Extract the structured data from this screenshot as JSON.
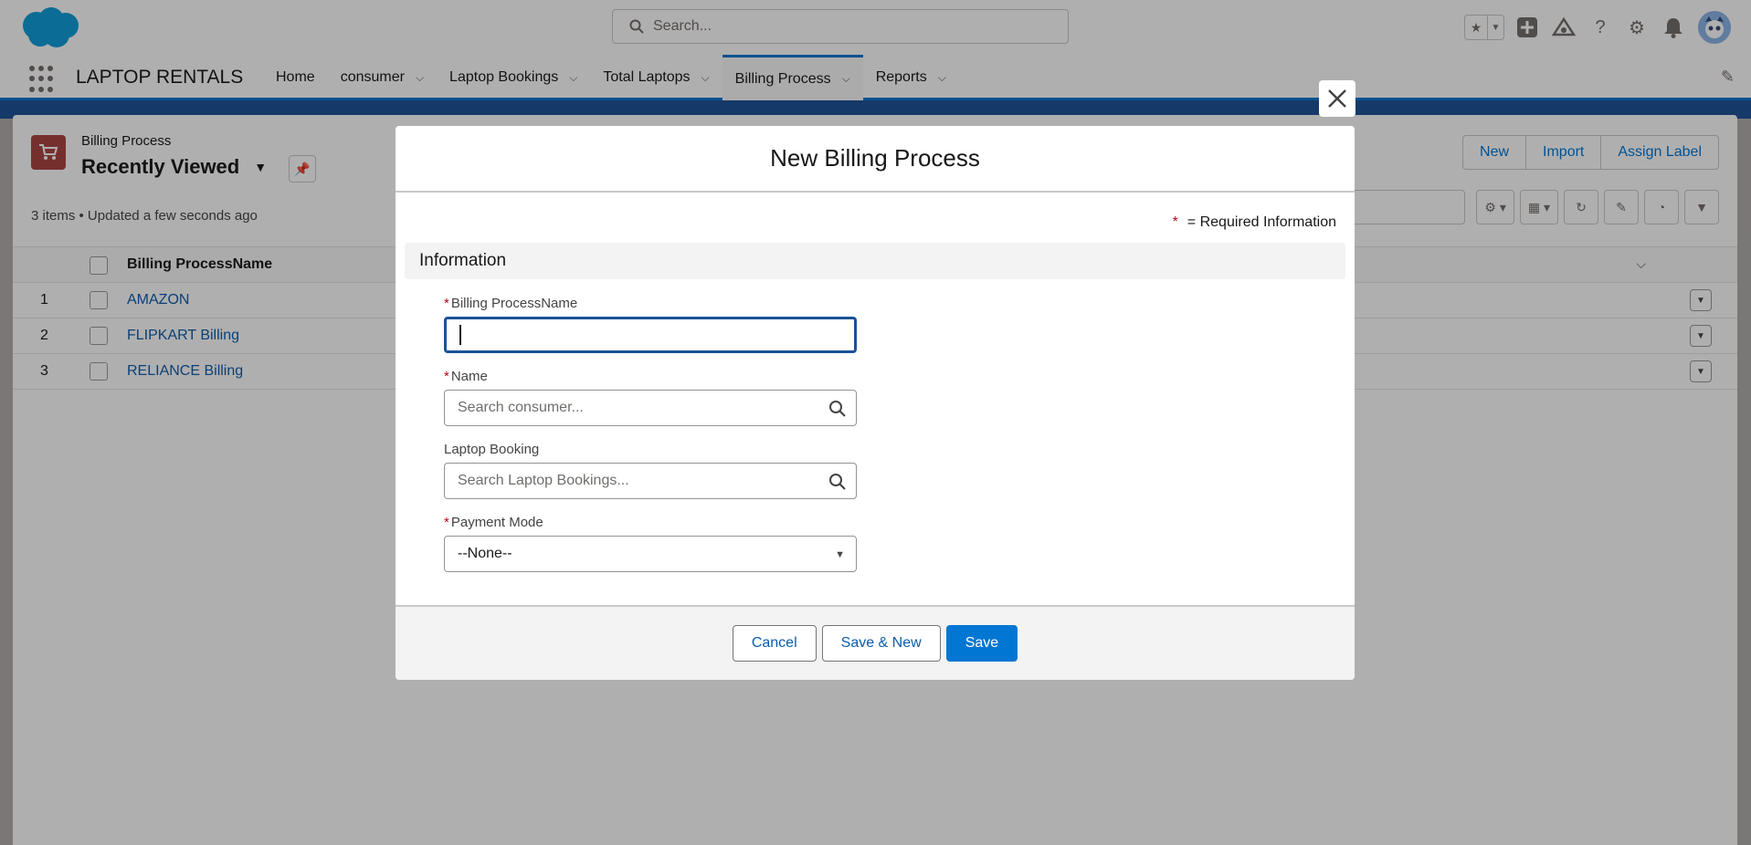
{
  "header": {
    "search_placeholder": "Search...",
    "icons": [
      "favorites-star-icon",
      "favorites-menu-icon",
      "add-icon",
      "trailhead-icon",
      "help-icon",
      "setup-gear-icon",
      "notifications-bell-icon",
      "avatar"
    ]
  },
  "nav": {
    "app_name": "LAPTOP RENTALS",
    "items": [
      {
        "label": "Home",
        "has_menu": false
      },
      {
        "label": "consumer",
        "has_menu": true
      },
      {
        "label": "Laptop Bookings",
        "has_menu": true
      },
      {
        "label": "Total Laptops",
        "has_menu": true
      },
      {
        "label": "Billing Process",
        "has_menu": true,
        "active": true
      },
      {
        "label": "Reports",
        "has_menu": true
      }
    ]
  },
  "list_view": {
    "object_label": "Billing Process",
    "view_name": "Recently Viewed",
    "meta": "3 items • Updated a few seconds ago",
    "actions": [
      "New",
      "Import",
      "Assign Label"
    ],
    "column_header": "Billing ProcessName",
    "rows": [
      {
        "num": "1",
        "name": "AMAZON"
      },
      {
        "num": "2",
        "name": "FLIPKART Billing"
      },
      {
        "num": "3",
        "name": "RELIANCE Billing"
      }
    ]
  },
  "modal": {
    "title": "New Billing Process",
    "required_star": "*",
    "required_text": "= Required Information",
    "section_title": "Information",
    "fields": {
      "billing_name": {
        "label": "Billing ProcessName",
        "required": true,
        "value": ""
      },
      "name": {
        "label": "Name",
        "required": true,
        "placeholder": "Search consumer..."
      },
      "laptop_booking": {
        "label": "Laptop Booking",
        "required": false,
        "placeholder": "Search Laptop Bookings..."
      },
      "payment_mode": {
        "label": "Payment Mode",
        "required": true,
        "value": "--None--"
      }
    },
    "buttons": {
      "cancel": "Cancel",
      "save_new": "Save & New",
      "save": "Save"
    }
  },
  "colors": {
    "brand": "#0176d3",
    "link": "#0b5cab",
    "required": "#ba0517",
    "object_icon": "#a94442"
  }
}
